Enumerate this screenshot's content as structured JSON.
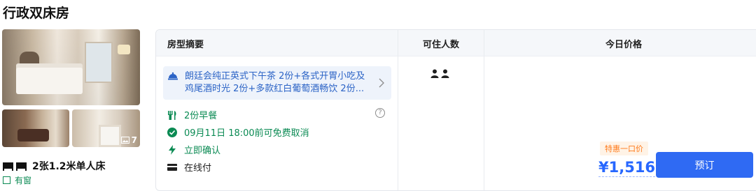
{
  "room": {
    "title": "行政双床房",
    "photo_count": "7",
    "bed_type": "2张1.2米单人床",
    "window": "有窗"
  },
  "table": {
    "headers": {
      "summary": "房型摘要",
      "guests": "可住人数",
      "price": "今日价格"
    },
    "package": {
      "text": "朗廷会纯正英式下午茶 2份+各式开胃小吃及鸡尾酒时光 2份+多款红白葡萄酒畅饮 2份..."
    },
    "features": {
      "breakfast": "2份早餐",
      "cancellation": "09月11日 18:00前可免费取消",
      "instant": "立即确认",
      "payment": "在线付"
    },
    "guests": {
      "icon": "two-persons-icon"
    },
    "pricing": {
      "promo_tag": "特惠一口价",
      "price": "¥1,516",
      "book_label": "预订"
    }
  },
  "colors": {
    "accent_blue": "#2f6af3",
    "price_blue": "#2767ff",
    "green": "#0a8a53",
    "promo_orange": "#ff7a1a",
    "package_bg": "#eef3fb"
  }
}
